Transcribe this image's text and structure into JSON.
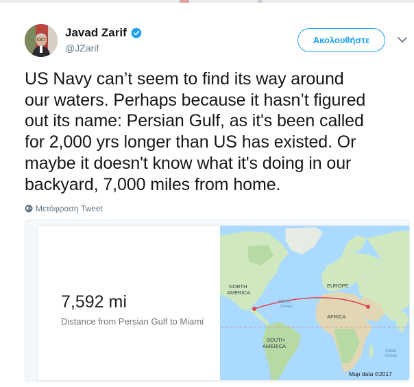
{
  "user": {
    "name": "Javad Zarif",
    "handle": "@JZarif",
    "verified": true
  },
  "follow_button_label": "Ακολουθήστε",
  "tweet": {
    "lines": [
      "US Navy can’t seem to find its way around",
      "our waters. Perhaps because it hasn’t figured",
      "out its name: Persian Gulf, as it's been called",
      "for 2,000 yrs longer than US has existed. Or",
      "maybe it doesn't know what it's doing in our",
      "backyard, 7,000 miles from home."
    ]
  },
  "translate_label": "Μετάφραση Tweet",
  "card": {
    "distance": "7,592 mi",
    "distance_label": "Distance from Persian Gulf to Miami",
    "map": {
      "labels": {
        "north_america": [
          "NORTH",
          "AMERICA"
        ],
        "europe": "EUROPE",
        "atlantic": [
          "Atlantic",
          "Ocean"
        ],
        "africa": "AFRICA",
        "south_america": [
          "SOUTH",
          "AMERICA"
        ],
        "indian": [
          "Indian",
          "Ocean"
        ]
      },
      "attribution": "Map data ©2017"
    }
  },
  "colors": {
    "accent": "#1da1f2",
    "route": "#e0454b",
    "water": "#aadaff",
    "land": "#cfe8c0"
  },
  "icons": [
    "verified-badge-icon",
    "chevron-down-icon",
    "globe-icon"
  ]
}
